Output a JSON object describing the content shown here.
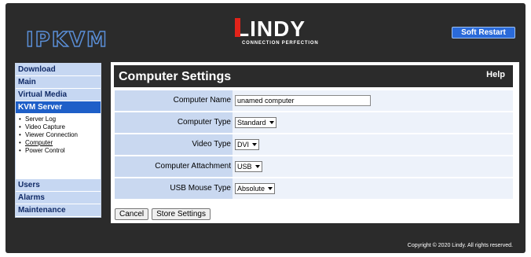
{
  "header": {
    "brand": "IPKVM",
    "logo_word": "LINDY",
    "logo_tagline": "CONNECTION PERFECTION",
    "soft_restart_label": "Soft Restart"
  },
  "sidebar": {
    "top_items": [
      {
        "label": "Download"
      },
      {
        "label": "Main"
      },
      {
        "label": "Virtual Media"
      },
      {
        "label": "KVM Server",
        "active": true
      }
    ],
    "sub_items": [
      {
        "label": "Server Log"
      },
      {
        "label": "Video Capture"
      },
      {
        "label": "Viewer Connection"
      },
      {
        "label": "Computer",
        "current": true
      },
      {
        "label": "Power Control"
      }
    ],
    "bottom_items": [
      {
        "label": "Users"
      },
      {
        "label": "Alarms"
      },
      {
        "label": "Maintenance"
      }
    ]
  },
  "panel": {
    "title": "Computer Settings",
    "help_label": "Help"
  },
  "form": {
    "computer_name": {
      "label": "Computer Name",
      "value": "unamed computer"
    },
    "computer_type": {
      "label": "Computer Type",
      "value": "Standard"
    },
    "video_type": {
      "label": "Video Type",
      "value": "DVI"
    },
    "computer_attachment": {
      "label": "Computer Attachment",
      "value": "USB"
    },
    "usb_mouse_type": {
      "label": "USB Mouse Type",
      "value": "Absolute"
    }
  },
  "actions": {
    "cancel_label": "Cancel",
    "store_label": "Store Settings"
  },
  "footer": {
    "copyright": "Copyright © 2020 Lindy. All rights reserved."
  },
  "colors": {
    "frame": "#2b2b2b",
    "accent": "#1e5fc8",
    "nav": "#c6d7f2",
    "label_bg": "#c9d8f0",
    "value_bg": "#edf2fa",
    "logo_red": "#e2231a"
  }
}
